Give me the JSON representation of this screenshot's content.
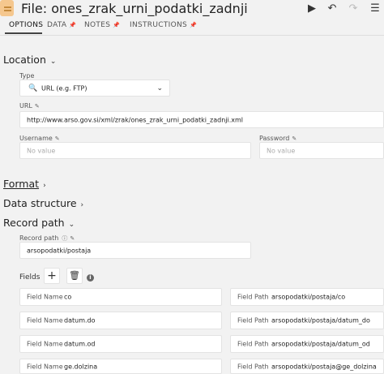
{
  "header": {
    "title": "File: ones_zrak_urni_podatki_zadnji",
    "icons": [
      "play-icon",
      "undo-icon",
      "redo-icon",
      "menu-icon"
    ]
  },
  "tabs": [
    {
      "label": "OPTIONS",
      "active": true
    },
    {
      "label": "DATA",
      "pinned": true
    },
    {
      "label": "NOTES",
      "pinned": true
    },
    {
      "label": "INSTRUCTIONS",
      "pinned": true
    }
  ],
  "location": {
    "header": "Location",
    "type_label": "Type",
    "type_value": "URL (e.g. FTP)",
    "url_label": "URL",
    "url_value": "http://www.arso.gov.si/xml/zrak/ones_zrak_urni_podatki_zadnji.xml",
    "username_label": "Username",
    "username_placeholder": "No value",
    "password_label": "Password",
    "password_placeholder": "No value"
  },
  "format": {
    "header": "Format"
  },
  "data_structure": {
    "header": "Data structure"
  },
  "record_path": {
    "header": "Record path",
    "label": "Record path",
    "value": "arsopodatki/postaja"
  },
  "fields": {
    "label": "Fields",
    "name_label": "Field Name",
    "path_label": "Field Path",
    "rows": [
      {
        "name": "co",
        "path": "arsopodatki/postaja/co"
      },
      {
        "name": "datum.do",
        "path": "arsopodatki/postaja/datum_do"
      },
      {
        "name": "datum.od",
        "path": "arsopodatki/postaja/datum_od"
      },
      {
        "name": "ge.dolzina",
        "path": "arsopodatki/postaja@ge_dolzina"
      }
    ]
  },
  "colors": {
    "background": "#f2f2f2",
    "file_icon": "#f5c78e"
  }
}
